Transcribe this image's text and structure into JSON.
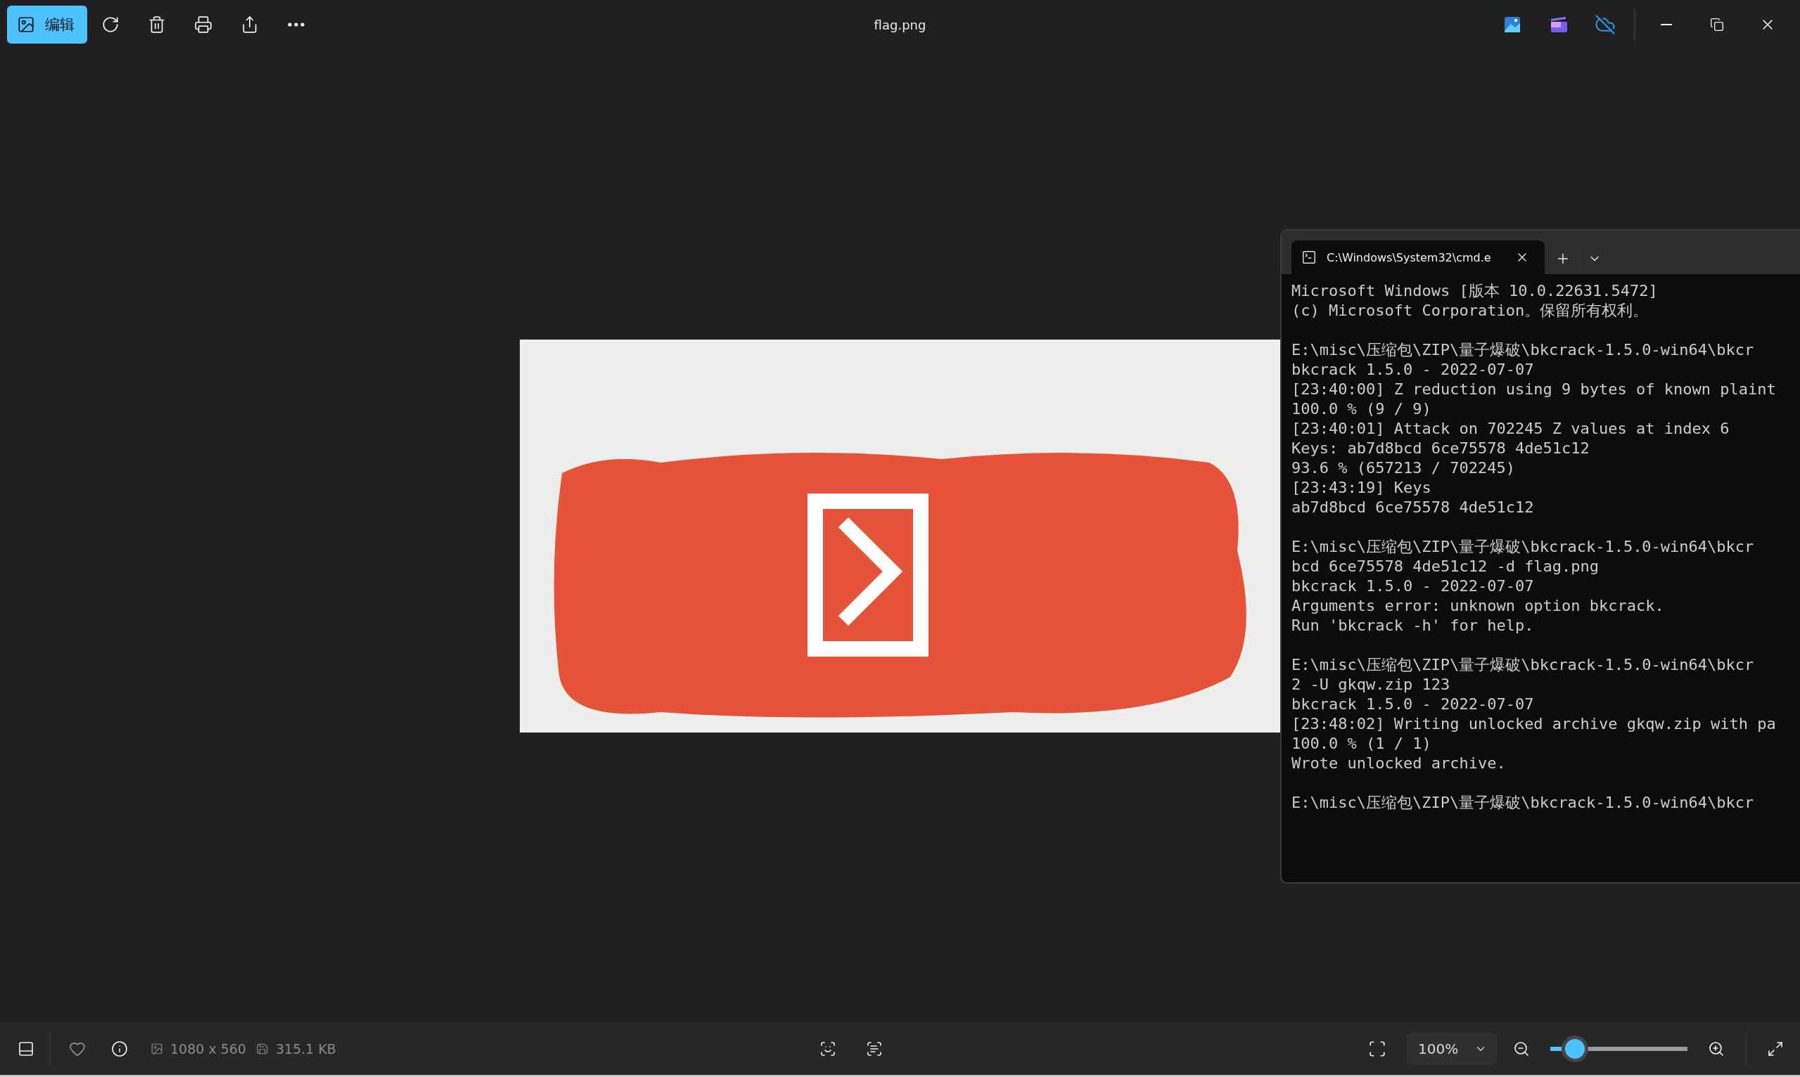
{
  "toolbar": {
    "edit_button": "编辑",
    "file_title": "flag.png"
  },
  "terminal": {
    "tab_title": "C:\\Windows\\System32\\cmd.e",
    "blocks": [
      [
        "Microsoft Windows [版本 10.0.22631.5472]",
        "(c) Microsoft Corporation。保留所有权利。"
      ],
      [
        "E:\\misc\\压缩包\\ZIP\\量子爆破\\bkcrack-1.5.0-win64\\bkcr",
        "bkcrack 1.5.0 - 2022-07-07",
        "[23:40:00] Z reduction using 9 bytes of known plaint",
        "100.0 % (9 / 9)",
        "[23:40:01] Attack on 702245 Z values at index 6",
        "Keys: ab7d8bcd 6ce75578 4de51c12",
        "93.6 % (657213 / 702245)",
        "[23:43:19] Keys",
        "ab7d8bcd 6ce75578 4de51c12"
      ],
      [
        "E:\\misc\\压缩包\\ZIP\\量子爆破\\bkcrack-1.5.0-win64\\bkcr",
        "bcd 6ce75578 4de51c12 -d flag.png",
        "bkcrack 1.5.0 - 2022-07-07",
        "Arguments error: unknown option bkcrack.",
        "Run 'bkcrack -h' for help."
      ],
      [
        "E:\\misc\\压缩包\\ZIP\\量子爆破\\bkcrack-1.5.0-win64\\bkcr",
        "2 -U gkqw.zip 123",
        "bkcrack 1.5.0 - 2022-07-07",
        "[23:48:02] Writing unlocked archive gkqw.zip with pa",
        "100.0 % (1 / 1)",
        "Wrote unlocked archive."
      ],
      [
        "E:\\misc\\压缩包\\ZIP\\量子爆破\\bkcrack-1.5.0-win64\\bkcr"
      ]
    ]
  },
  "status_bar": {
    "dimensions": "1080 x 560",
    "file_size": "315.1 KB",
    "zoom": "100%",
    "zoom_slider": {
      "level": 0.18
    }
  }
}
